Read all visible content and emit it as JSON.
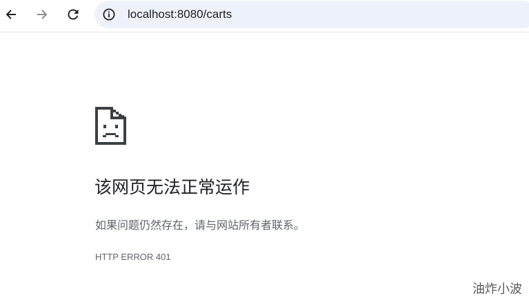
{
  "browser": {
    "back_icon": "arrow-left-icon",
    "forward_icon": "arrow-right-icon",
    "reload_icon": "reload-icon",
    "site_info_icon": "info-circle-icon",
    "url": "localhost:8080/carts",
    "omnibox_color": "#edf2fa"
  },
  "error_page": {
    "icon": "sad-page-icon",
    "title": "该网页无法正常运作",
    "message": "如果问题仍然存在，请与网站所有者联系。",
    "error_code": "HTTP ERROR 401"
  },
  "watermark": {
    "text": "油炸小波"
  },
  "colors": {
    "icon_dark": "#1f1f1f",
    "icon_disabled": "#8c8c8c",
    "title_text": "#202124",
    "secondary_text": "#5f6368"
  }
}
